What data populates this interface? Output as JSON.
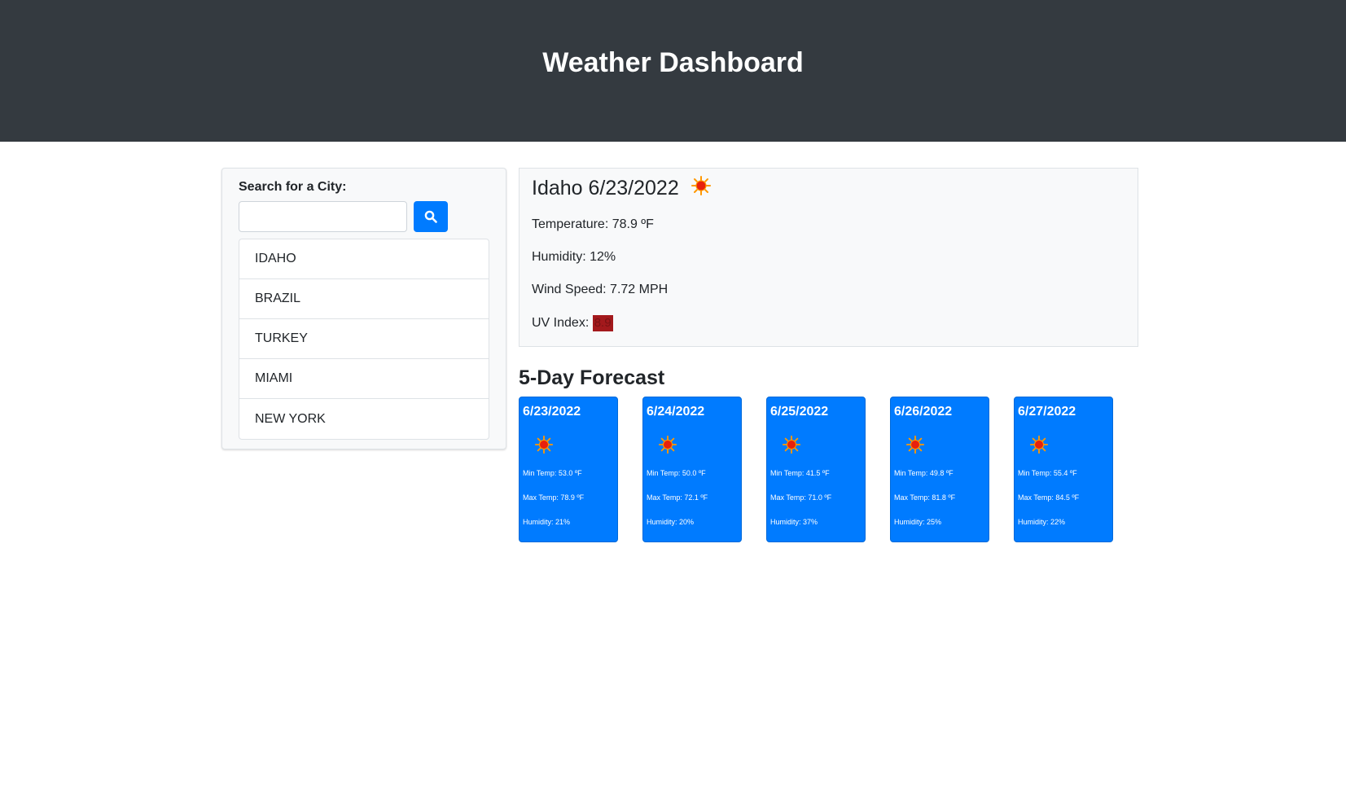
{
  "header": {
    "title": "Weather Dashboard"
  },
  "search": {
    "label": "Search for a City:",
    "input_value": "",
    "button_icon": "search-icon"
  },
  "cities": [
    "IDAHO",
    "BRAZIL",
    "TURKEY",
    "MIAMI",
    "NEW YORK"
  ],
  "current": {
    "title": "Idaho 6/23/2022",
    "icon": "sun-icon",
    "temperature": "Temperature: 78.9 ºF",
    "humidity": "Humidity: 12%",
    "wind": "Wind Speed: 7.72 MPH",
    "uv_label": "UV Index: ",
    "uv_value": "8.9",
    "uv_color": "#a3191c"
  },
  "forecast": {
    "heading": "5-Day Forecast",
    "days": [
      {
        "date": "6/23/2022",
        "icon": "sun-icon",
        "min": "Min Temp: 53.0 ºF",
        "max": "Max Temp: 78.9 ºF",
        "humidity": "Humidity: 21%"
      },
      {
        "date": "6/24/2022",
        "icon": "sun-icon",
        "min": "Min Temp: 50.0 ºF",
        "max": "Max Temp: 72.1 ºF",
        "humidity": "Humidity: 20%"
      },
      {
        "date": "6/25/2022",
        "icon": "sun-icon",
        "min": "Min Temp: 41.5 ºF",
        "max": "Max Temp: 71.0 ºF",
        "humidity": "Humidity: 37%"
      },
      {
        "date": "6/26/2022",
        "icon": "sun-icon",
        "min": "Min Temp: 49.8 ºF",
        "max": "Max Temp: 81.8 ºF",
        "humidity": "Humidity: 25%"
      },
      {
        "date": "6/27/2022",
        "icon": "sun-icon",
        "min": "Min Temp: 55.4 ºF",
        "max": "Max Temp: 84.5 ºF",
        "humidity": "Humidity: 22%"
      }
    ]
  },
  "colors": {
    "header_bg": "#343a40",
    "accent": "#007bff",
    "panel_bg": "#f8f9fa"
  }
}
